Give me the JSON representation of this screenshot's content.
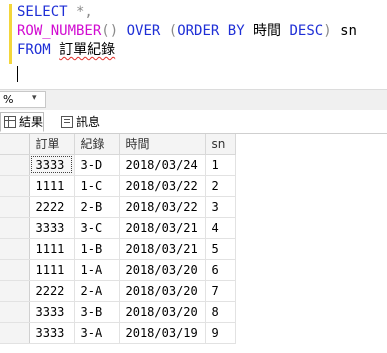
{
  "editor": {
    "line1": {
      "kw": "SELECT",
      "rest": " *,"
    },
    "line2": {
      "fn": "ROW_NUMBER",
      "p1": "()",
      "sp1": " ",
      "kw1": "OVER",
      "sp2": " ",
      "p2": "(",
      "kw2": "ORDER BY",
      "col": " 時間 ",
      "kw3": "DESC",
      "p3": ")",
      "alias": " sn"
    },
    "line3": {
      "kw": "FROM",
      "sp": " ",
      "table": "訂單紀錄"
    }
  },
  "zoom": {
    "value": "%",
    "arrow": "▾"
  },
  "tabs": [
    {
      "label": "結果",
      "icon": "grid-icon"
    },
    {
      "label": "訊息",
      "icon": "message-icon"
    }
  ],
  "grid": {
    "columns": [
      "",
      "訂單",
      "紀錄",
      "時間",
      "sn"
    ],
    "rows": [
      [
        "",
        "3333",
        "3-D",
        "2018/03/24",
        "1"
      ],
      [
        "",
        "1111",
        "1-C",
        "2018/03/22",
        "2"
      ],
      [
        "",
        "2222",
        "2-B",
        "2018/03/22",
        "3"
      ],
      [
        "",
        "3333",
        "3-C",
        "2018/03/21",
        "4"
      ],
      [
        "",
        "1111",
        "1-B",
        "2018/03/21",
        "5"
      ],
      [
        "",
        "1111",
        "1-A",
        "2018/03/20",
        "6"
      ],
      [
        "",
        "2222",
        "2-A",
        "2018/03/20",
        "7"
      ],
      [
        "",
        "3333",
        "3-B",
        "2018/03/20",
        "8"
      ],
      [
        "",
        "3333",
        "3-A",
        "2018/03/19",
        "9"
      ]
    ]
  }
}
